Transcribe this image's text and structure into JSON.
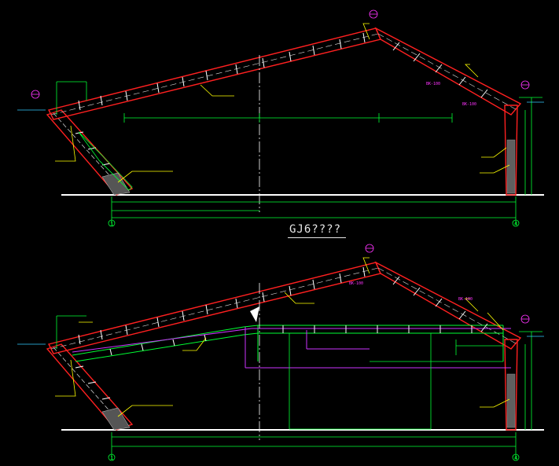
{
  "drawing": {
    "section_title": "GJ6????",
    "axis_labels": {
      "left": "1",
      "right": "4"
    },
    "section_tags": [
      "BK-100",
      "BK-100",
      "BK-100",
      "BK-100"
    ],
    "colors": {
      "background": "#000000",
      "steel": "#ff2020",
      "dimension": "#00ff33",
      "leader": "#ffff00",
      "center_line": "#ffffff",
      "bracing": "#cc33ff",
      "symbol": "#ff33ff",
      "water": "#33ccff"
    }
  }
}
